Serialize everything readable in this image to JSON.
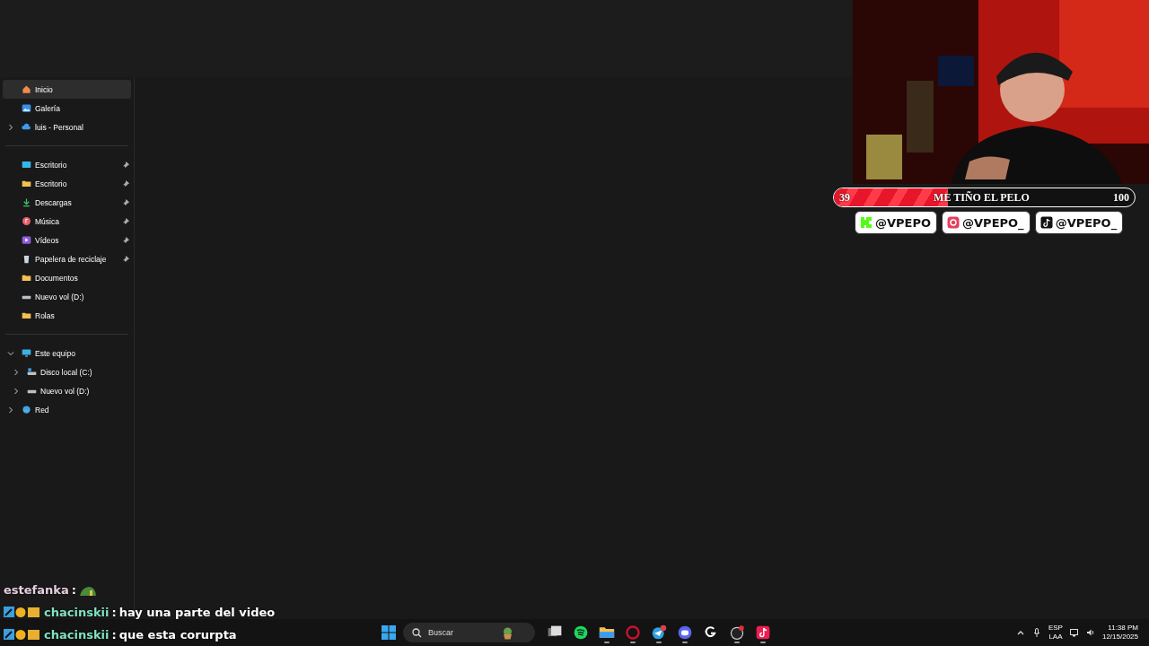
{
  "sidebar": {
    "groups": [
      [
        {
          "label": "Inicio",
          "kind": "home",
          "selected": true
        },
        {
          "label": "Galería",
          "kind": "gallery",
          "selected": false
        },
        {
          "label": "luis - Personal",
          "kind": "cloud",
          "selected": false,
          "expanded": false
        }
      ],
      [
        {
          "label": "Escritorio",
          "kind": "desktop",
          "selected": false,
          "pinned": true
        },
        {
          "label": "Escritorio",
          "kind": "folder",
          "selected": false,
          "pinned": true
        },
        {
          "label": "Descargas",
          "kind": "download",
          "selected": false,
          "pinned": true
        },
        {
          "label": "Música",
          "kind": "music",
          "selected": false,
          "pinned": true
        },
        {
          "label": "Vídeos",
          "kind": "video",
          "selected": false,
          "pinned": true
        },
        {
          "label": "Papelera de reciclaje",
          "kind": "bin",
          "selected": false,
          "pinned": true
        },
        {
          "label": "Documentos",
          "kind": "folder",
          "selected": false,
          "pinned": false
        },
        {
          "label": "Nuevo vol (D:)",
          "kind": "drive",
          "selected": false,
          "pinned": false
        },
        {
          "label": "Rolas",
          "kind": "folder",
          "selected": false,
          "pinned": false
        }
      ],
      [
        {
          "label": "Este equipo",
          "kind": "pc",
          "selected": false,
          "expanded": true,
          "children": [
            {
              "label": "Disco local (C:)",
              "kind": "sysdrive",
              "selected": false,
              "expanded": false
            },
            {
              "label": "Nuevo vol (D:)",
              "kind": "drive",
              "selected": false,
              "expanded": false
            }
          ]
        },
        {
          "label": "Red",
          "kind": "network",
          "selected": false,
          "expanded": false
        }
      ]
    ]
  },
  "goal": {
    "start": "39",
    "title": "ME TIÑO EL PELO",
    "end": "100",
    "level": 0.38
  },
  "socials": [
    {
      "kind": "kick",
      "handle": "@VPEPO"
    },
    {
      "kind": "instagram",
      "handle": "@VPEPO_"
    },
    {
      "kind": "tiktok",
      "handle": "@VPEPO_"
    }
  ],
  "chat": [
    {
      "user": "estefanka",
      "color": "#e6cfe0",
      "separator": ":",
      "kind": "emote"
    },
    {
      "user": "chacinskii",
      "color": "#7fe3c4",
      "separator": ":",
      "kind": "text",
      "text": "hay una parte del video",
      "badges": true
    },
    {
      "user": "chacinskii",
      "color": "#7fe3c4",
      "separator": ":",
      "kind": "text",
      "text": "que esta corurpta",
      "badges": true
    }
  ],
  "taskbar": {
    "search": {
      "placeholder": "Buscar"
    },
    "apps": [
      {
        "kind": "taskview",
        "running": false
      },
      {
        "kind": "spotify",
        "running": false
      },
      {
        "kind": "explorer",
        "running": true
      },
      {
        "kind": "opera",
        "running": true
      },
      {
        "kind": "telegram",
        "running": true
      },
      {
        "kind": "discord",
        "running": true
      },
      {
        "kind": "ghub",
        "running": false
      },
      {
        "kind": "obs",
        "running": true
      },
      {
        "kind": "tiktok",
        "running": true
      }
    ],
    "tray": {
      "language": "ESP",
      "layout": "LAA",
      "time": "11:38 PM",
      "date": "12/15/2025"
    }
  }
}
